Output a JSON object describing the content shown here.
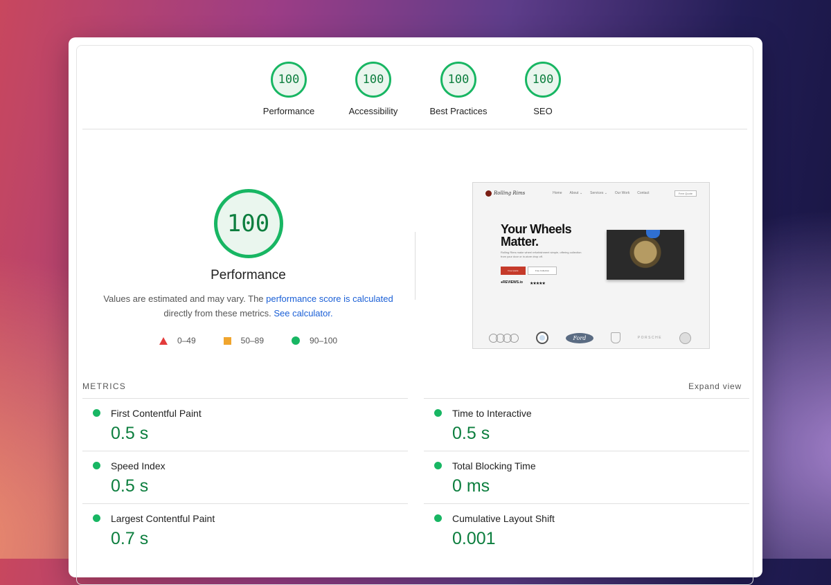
{
  "gauges": [
    {
      "score": "100",
      "label": "Performance"
    },
    {
      "score": "100",
      "label": "Accessibility"
    },
    {
      "score": "100",
      "label": "Best Practices"
    },
    {
      "score": "100",
      "label": "SEO"
    }
  ],
  "performance": {
    "score": "100",
    "title": "Performance",
    "desc_prefix": "Values are estimated and may vary. The ",
    "link_score": "performance score is calculated",
    "desc_middle": "directly from these metrics. ",
    "link_calc": "See calculator.",
    "legend": [
      {
        "range": "0–49",
        "color": "#e33b3b"
      },
      {
        "range": "50–89",
        "color": "#f0a52e"
      },
      {
        "range": "90–100",
        "color": "#18b663"
      }
    ]
  },
  "screenshot": {
    "logo": "Rolling Rims",
    "nav": [
      "Home",
      "About ⌄",
      "Services ⌄",
      "Our Work",
      "Contact"
    ],
    "quote_btn": "Free Quote",
    "headline1": "Your Wheels",
    "headline2": "Matter.",
    "paragraph": "Rolling Rims make wheel refurbishment simple, offering collection from your door or in-store drop off.",
    "btn_primary": "Free Quote",
    "btn_secondary": "Free Collection",
    "reviews": "●REVIEWS.io",
    "stars": "★★★★★",
    "brand_ford": "Ford",
    "brand_porsche": "PORSCHE"
  },
  "metrics": {
    "heading": "METRICS",
    "expand": "Expand view",
    "left": [
      {
        "name": "First Contentful Paint",
        "value": "0.5 s"
      },
      {
        "name": "Speed Index",
        "value": "0.5 s"
      },
      {
        "name": "Largest Contentful Paint",
        "value": "0.7 s"
      }
    ],
    "right": [
      {
        "name": "Time to Interactive",
        "value": "0.5 s"
      },
      {
        "name": "Total Blocking Time",
        "value": "0 ms"
      },
      {
        "name": "Cumulative Layout Shift",
        "value": "0.001"
      }
    ]
  },
  "colors": {
    "pass": "#18b663",
    "pass_text": "#0c7e3e",
    "link": "#1a5fd6"
  }
}
